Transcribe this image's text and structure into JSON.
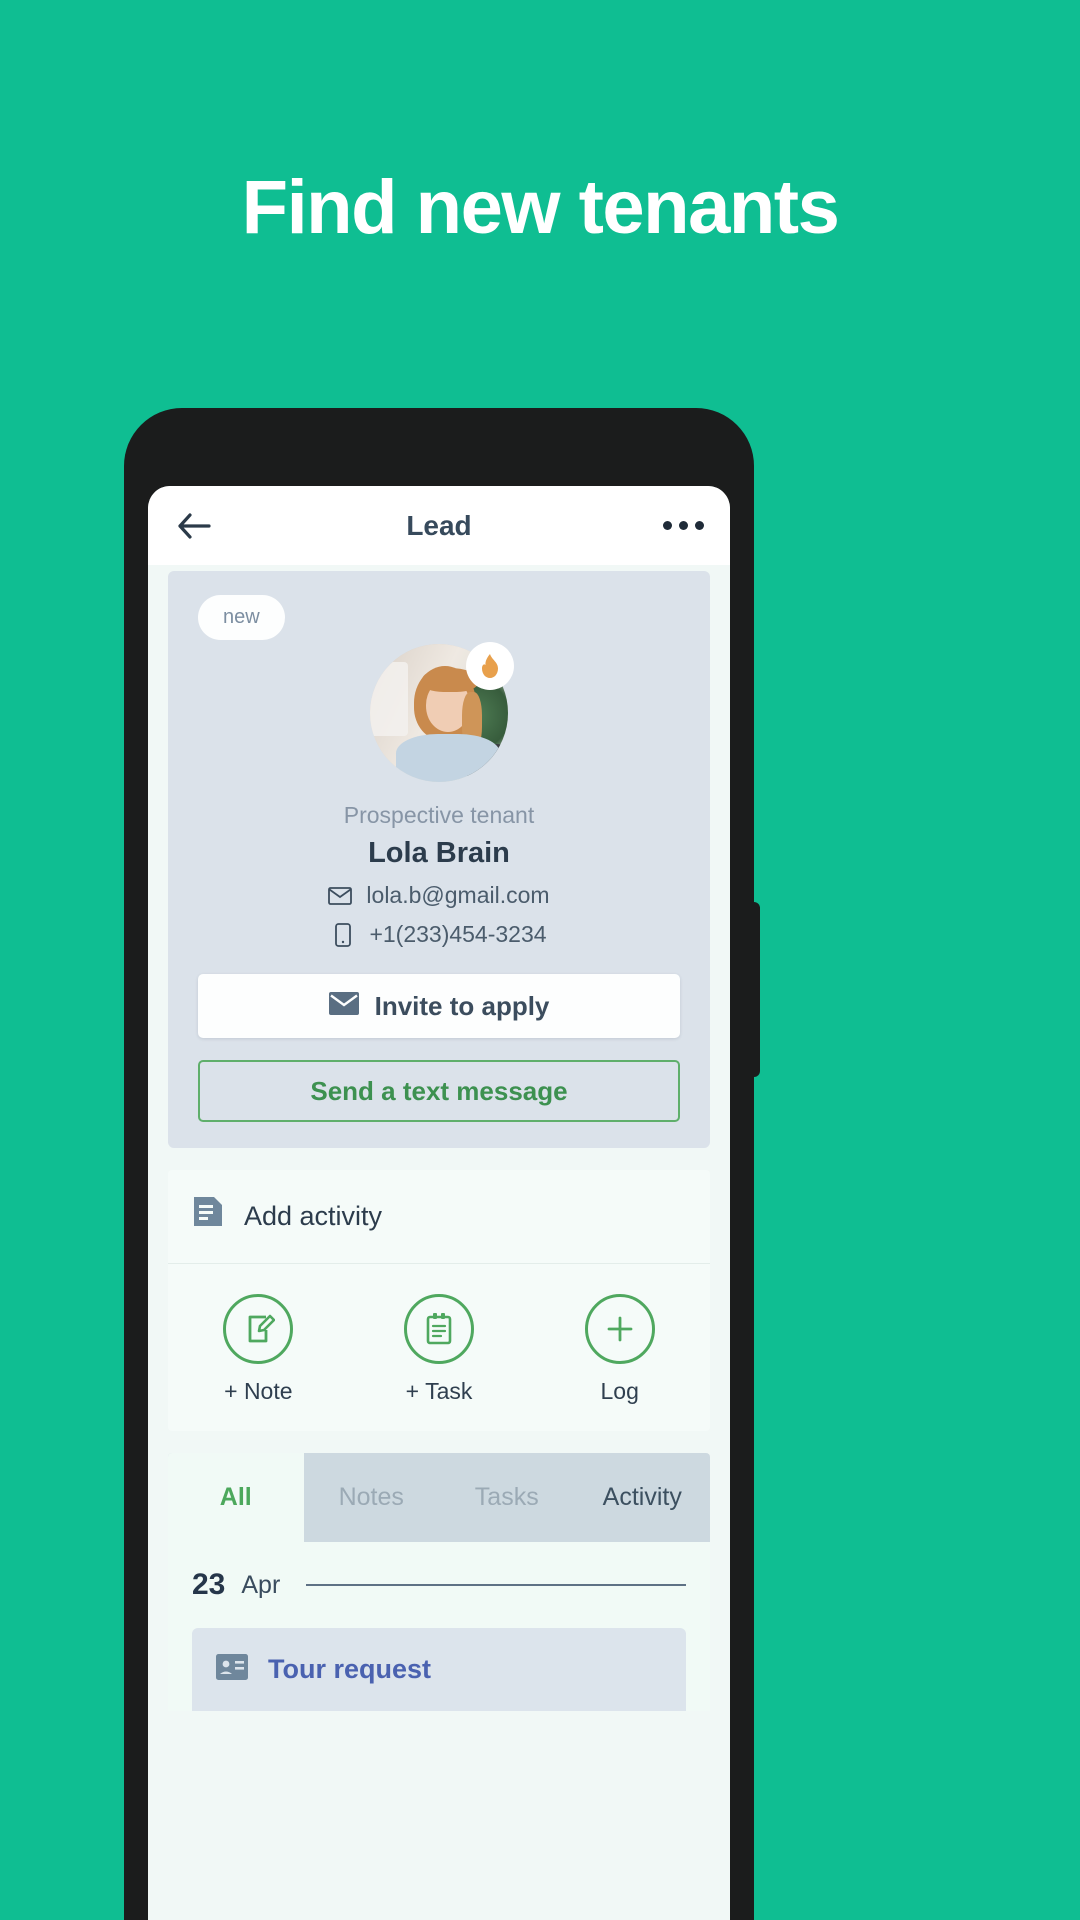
{
  "hero": {
    "headline": "Find new tenants",
    "background_color": "#0FBE92"
  },
  "appbar": {
    "title": "Lead",
    "back_icon": "arrow-left-icon",
    "menu_icon": "more-horizontal-icon"
  },
  "profile": {
    "status_badge": "new",
    "avatar_badge_icon": "flame-icon",
    "role": "Prospective tenant",
    "name": "Lola Brain",
    "email": "lola.b@gmail.com",
    "email_icon": "envelope-icon",
    "phone": "+1(233)454-3234",
    "phone_icon": "mobile-icon",
    "primary_button": {
      "label": "Invite to apply",
      "icon": "envelope-icon"
    },
    "secondary_button": {
      "label": "Send a text message"
    }
  },
  "add_activity": {
    "title": "Add activity",
    "title_icon": "document-icon",
    "actions": [
      {
        "label": "+ Note",
        "icon": "note-edit-icon"
      },
      {
        "label": "+ Task",
        "icon": "clipboard-icon"
      },
      {
        "label": "Log",
        "icon": "plus-circle-icon"
      }
    ]
  },
  "tabs": [
    {
      "label": "All",
      "active": true
    },
    {
      "label": "Notes",
      "active": false
    },
    {
      "label": "Tasks",
      "active": false
    },
    {
      "label": "Activity",
      "active": false
    }
  ],
  "timeline": {
    "date_day": "23",
    "date_month": "Apr",
    "entries": [
      {
        "title": "Tour request",
        "icon": "contact-card-icon"
      }
    ]
  },
  "colors": {
    "brand_green": "#0FBE92",
    "accent_green": "#4CA85C",
    "link_blue": "#4A62B0",
    "flame_orange": "#E8A04C"
  }
}
